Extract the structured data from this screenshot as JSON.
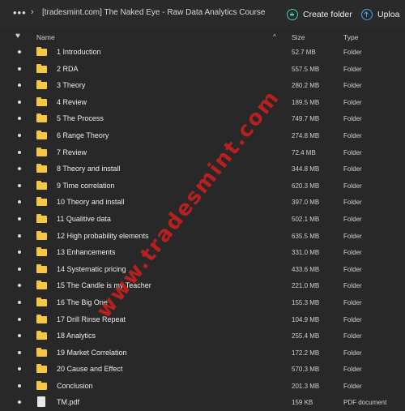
{
  "header": {
    "more_label": "•••",
    "chevron": "›",
    "breadcrumb": "[tradesmint.com] The Naked Eye - Raw Data Analytics Course",
    "create_folder_label": "Create folder",
    "upload_label": "Uploa"
  },
  "table": {
    "heart": "♥",
    "col_name": "Name",
    "sort_indicator": "^",
    "col_size": "Size",
    "col_type": "Type",
    "rows": [
      {
        "name": "1 Introduction",
        "size": "52.7 MB",
        "type": "Folder",
        "kind": "folder"
      },
      {
        "name": "2 RDA",
        "size": "557.5 MB",
        "type": "Folder",
        "kind": "folder"
      },
      {
        "name": "3 Theory",
        "size": "280.2 MB",
        "type": "Folder",
        "kind": "folder"
      },
      {
        "name": "4 Review",
        "size": "189.5 MB",
        "type": "Folder",
        "kind": "folder"
      },
      {
        "name": "5 The Process",
        "size": "749.7 MB",
        "type": "Folder",
        "kind": "folder"
      },
      {
        "name": "6 Range Theory",
        "size": "274.8 MB",
        "type": "Folder",
        "kind": "folder"
      },
      {
        "name": "7 Review",
        "size": "72.4 MB",
        "type": "Folder",
        "kind": "folder"
      },
      {
        "name": "8 Theory and install",
        "size": "344.8 MB",
        "type": "Folder",
        "kind": "folder"
      },
      {
        "name": "9 Time correlation",
        "size": "620.3 MB",
        "type": "Folder",
        "kind": "folder"
      },
      {
        "name": "10 Theory and install",
        "size": "397.0 MB",
        "type": "Folder",
        "kind": "folder"
      },
      {
        "name": "11 Qualitive data",
        "size": "502.1 MB",
        "type": "Folder",
        "kind": "folder"
      },
      {
        "name": "12 High probability elements",
        "size": "635.5 MB",
        "type": "Folder",
        "kind": "folder"
      },
      {
        "name": "13 Enhancements",
        "size": "331.0 MB",
        "type": "Folder",
        "kind": "folder"
      },
      {
        "name": "14 Systematic pricing",
        "size": "433.6 MB",
        "type": "Folder",
        "kind": "folder"
      },
      {
        "name": "15 The Candle is my Teacher",
        "size": "221.0 MB",
        "type": "Folder",
        "kind": "folder"
      },
      {
        "name": "16 The Big One",
        "size": "155.3 MB",
        "type": "Folder",
        "kind": "folder"
      },
      {
        "name": "17 Drill Rinse Repeat",
        "size": "104.9 MB",
        "type": "Folder",
        "kind": "folder"
      },
      {
        "name": "18 Analytics",
        "size": "255.4 MB",
        "type": "Folder",
        "kind": "folder"
      },
      {
        "name": "19 Market Correlation",
        "size": "172.2 MB",
        "type": "Folder",
        "kind": "folder"
      },
      {
        "name": "20 Cause and Effect",
        "size": "570.3 MB",
        "type": "Folder",
        "kind": "folder"
      },
      {
        "name": "Conclusion",
        "size": "201.3 MB",
        "type": "Folder",
        "kind": "folder"
      },
      {
        "name": "TM.pdf",
        "size": "159 KB",
        "type": "PDF document",
        "kind": "pdf"
      }
    ]
  },
  "watermark": "www.tradesmint.com",
  "colors": {
    "background": "#282828",
    "folder": "#f5c842",
    "accent_create": "#3fd3b4",
    "accent_upload": "#3aa7e8",
    "watermark": "#d21f1f"
  }
}
